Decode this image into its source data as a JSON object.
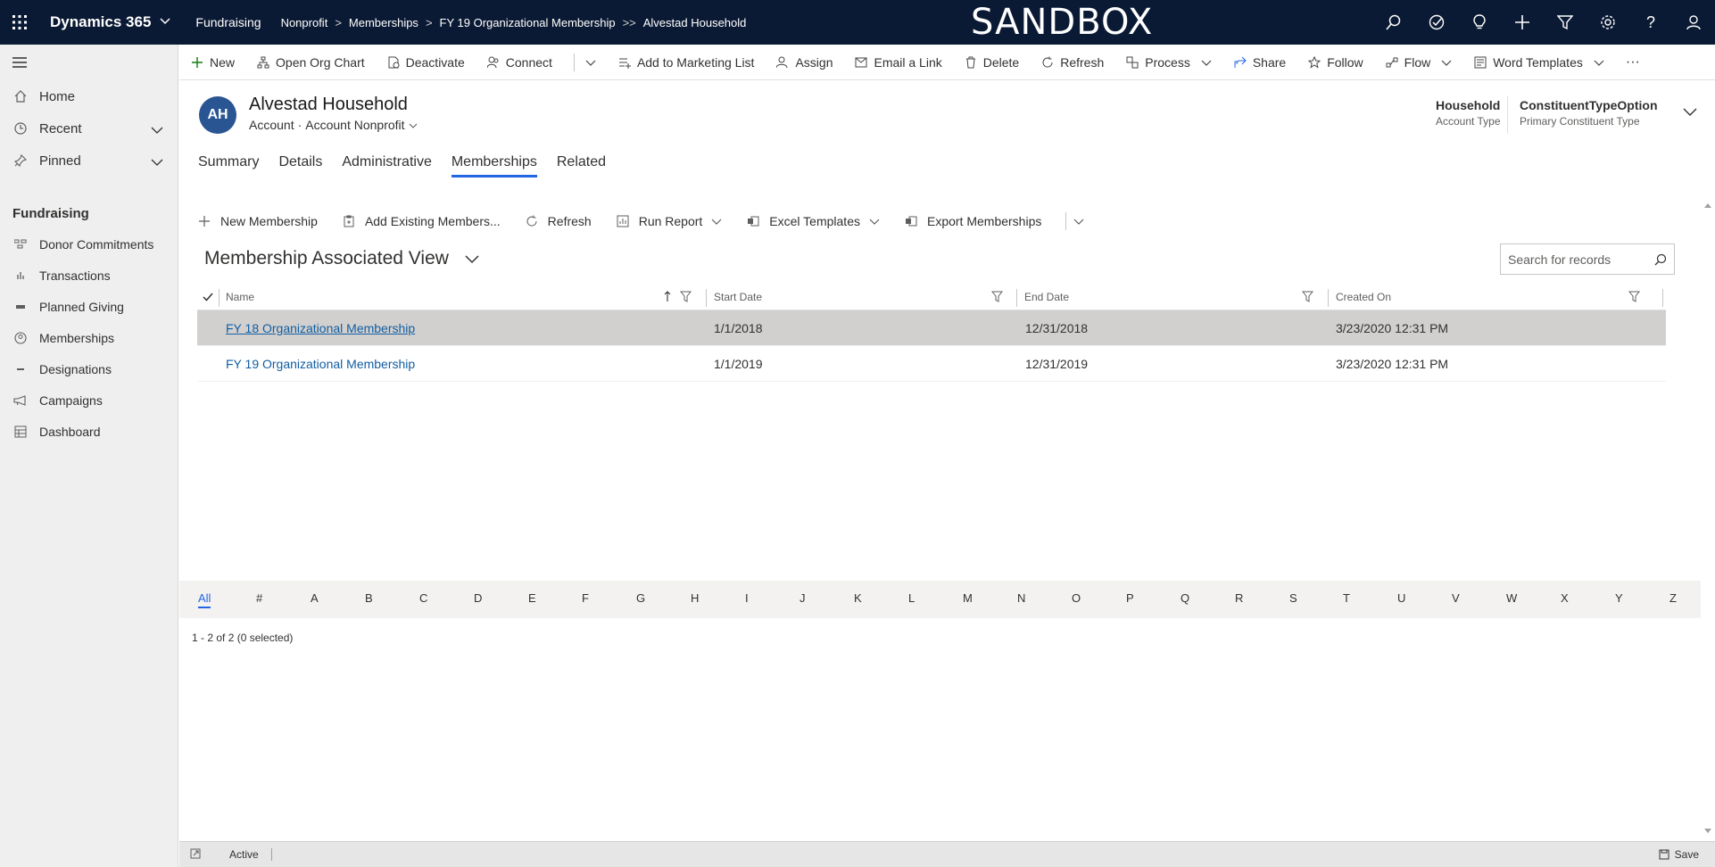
{
  "topbar": {
    "app_name": "Dynamics 365",
    "module": "Fundraising",
    "breadcrumbs": [
      "Nonprofit",
      "Memberships",
      "FY 19 Organizational Membership",
      "Alvestad Household"
    ],
    "banner": "SANDBOX"
  },
  "leftnav": {
    "items": [
      {
        "label": "Home"
      },
      {
        "label": "Recent"
      },
      {
        "label": "Pinned"
      }
    ],
    "group": "Fundraising",
    "sub_items": [
      {
        "label": "Donor Commitments"
      },
      {
        "label": "Transactions"
      },
      {
        "label": "Planned Giving"
      },
      {
        "label": "Memberships"
      },
      {
        "label": "Designations"
      },
      {
        "label": "Campaigns"
      },
      {
        "label": "Dashboard"
      }
    ]
  },
  "commandbar": {
    "new": "New",
    "open_org_chart": "Open Org Chart",
    "deactivate": "Deactivate",
    "connect": "Connect",
    "add_to_marketing_list": "Add to Marketing List",
    "assign": "Assign",
    "email_link": "Email a Link",
    "delete": "Delete",
    "refresh": "Refresh",
    "process": "Process",
    "share": "Share",
    "follow": "Follow",
    "flow": "Flow",
    "word_templates": "Word Templates",
    "more": "···"
  },
  "record": {
    "initials": "AH",
    "title": "Alvestad Household",
    "entity": "Account",
    "separator": "·",
    "form": "Account Nonprofit",
    "fields": [
      {
        "value": "Household",
        "label": "Account Type"
      },
      {
        "value": "ConstituentTypeOption",
        "label": "Primary Constituent Type"
      }
    ]
  },
  "tabs": [
    {
      "label": "Summary"
    },
    {
      "label": "Details"
    },
    {
      "label": "Administrative"
    },
    {
      "label": "Memberships"
    },
    {
      "label": "Related"
    }
  ],
  "subgrid": {
    "commands": {
      "new_membership": "New Membership",
      "add_existing": "Add Existing Members...",
      "refresh": "Refresh",
      "run_report": "Run Report",
      "excel_templates": "Excel Templates",
      "export": "Export Memberships"
    },
    "view_title": "Membership Associated View",
    "search_placeholder": "Search for records",
    "columns": [
      "Name",
      "Start Date",
      "End Date",
      "Created On"
    ],
    "rows": [
      {
        "name": "FY 18 Organizational Membership",
        "start": "1/1/2018",
        "end": "12/31/2018",
        "created": "3/23/2020 12:31 PM"
      },
      {
        "name": "FY 19 Organizational Membership",
        "start": "1/1/2019",
        "end": "12/31/2019",
        "created": "3/23/2020 12:31 PM"
      }
    ],
    "jump_letters": [
      "All",
      "#",
      "A",
      "B",
      "C",
      "D",
      "E",
      "F",
      "G",
      "H",
      "I",
      "J",
      "K",
      "L",
      "M",
      "N",
      "O",
      "P",
      "Q",
      "R",
      "S",
      "T",
      "U",
      "V",
      "W",
      "X",
      "Y",
      "Z"
    ],
    "record_count": "1 - 2 of 2 (0 selected)"
  },
  "statusbar": {
    "state": "Active",
    "save": "Save"
  },
  "colors": {
    "topbar_bg": "#0b1a34",
    "accent": "#2266e3",
    "link": "#115ea3",
    "avatar": "#2a5593"
  }
}
